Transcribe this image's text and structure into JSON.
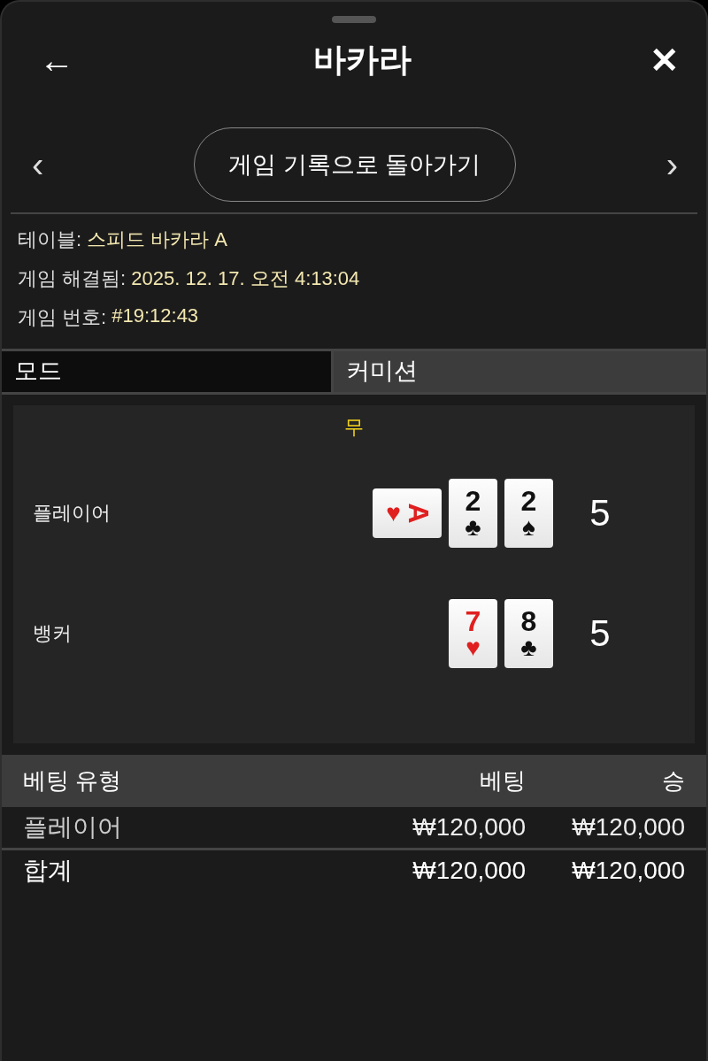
{
  "header": {
    "title": "바카라",
    "back": "←",
    "close": "✕"
  },
  "nav": {
    "prev": "‹",
    "button": "게임 기록으로 돌아가기",
    "next": "›"
  },
  "info": [
    {
      "label": "테이블:",
      "value": "스피드 바카라 A"
    },
    {
      "label": "게임 해결됨:",
      "value": "2025. 12. 17. 오전 4:13:04"
    },
    {
      "label": "게임 번호:",
      "value": "#19:12:43"
    }
  ],
  "mode": {
    "label": "모드",
    "value": "커미션"
  },
  "result": {
    "outcome": "무",
    "hands": [
      {
        "name": "플레이어",
        "score": "5",
        "cards": [
          {
            "rank": "A",
            "suit": "♥",
            "color": "#e02020",
            "kind": "sideways"
          },
          {
            "rank": "2",
            "suit": "♣",
            "color": "#111111",
            "kind": "upright"
          },
          {
            "rank": "2",
            "suit": "♠",
            "color": "#111111",
            "kind": "upright"
          }
        ]
      },
      {
        "name": "뱅커",
        "score": "5",
        "cards": [
          {
            "rank": "7",
            "suit": "♥",
            "color": "#e02020",
            "kind": "upright"
          },
          {
            "rank": "8",
            "suit": "♣",
            "color": "#111111",
            "kind": "upright"
          }
        ]
      }
    ]
  },
  "bets": {
    "columns": [
      "베팅 유형",
      "베팅",
      "승"
    ],
    "rows": [
      {
        "kind": "item",
        "cells": [
          "플레이어",
          "₩120,000",
          "₩120,000"
        ]
      },
      {
        "kind": "total",
        "cells": [
          "합계",
          "₩120,000",
          "₩120,000"
        ]
      }
    ]
  }
}
